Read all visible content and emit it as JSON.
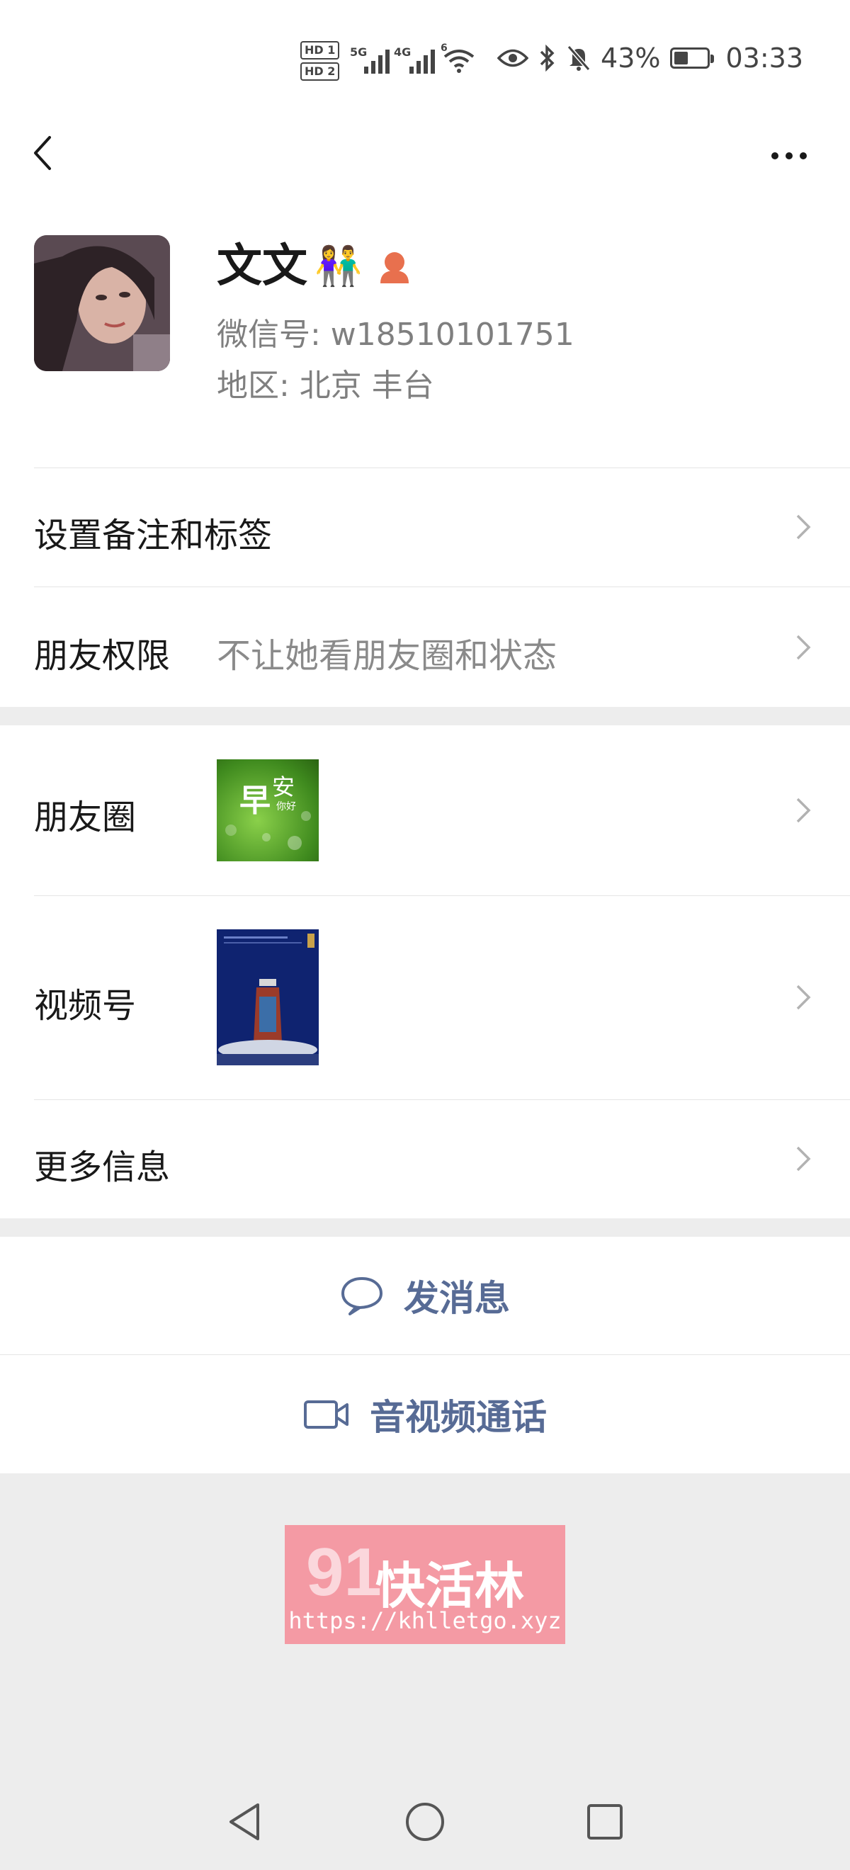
{
  "status_bar": {
    "sim1": "HD 1",
    "sim2": "HD 2",
    "net1": "5G",
    "net2": "4G",
    "wifi": "6",
    "battery_percent": "43%",
    "battery_level": 0.43,
    "time": "03:33"
  },
  "profile": {
    "name": "文文",
    "name_emoji": "👫",
    "wechat_id": "微信号:  w18510101751",
    "region": "地区:  北京  丰台"
  },
  "rows": {
    "remark_label": "设置备注和标签",
    "permission_label": "朋友权限",
    "permission_value": "不让她看朋友圈和状态",
    "moments_label": "朋友圈",
    "moments_thumb_text1": "早",
    "moments_thumb_text2": "安",
    "moments_thumb_text3": "你好",
    "channels_label": "视频号",
    "more_info_label": "更多信息"
  },
  "actions": {
    "message_label": "发消息",
    "call_label": "音视频通话",
    "accent_color": "#576b95"
  },
  "watermark": {
    "number": "91",
    "title": "快活林",
    "url": "https://khlletgo.xyz"
  }
}
